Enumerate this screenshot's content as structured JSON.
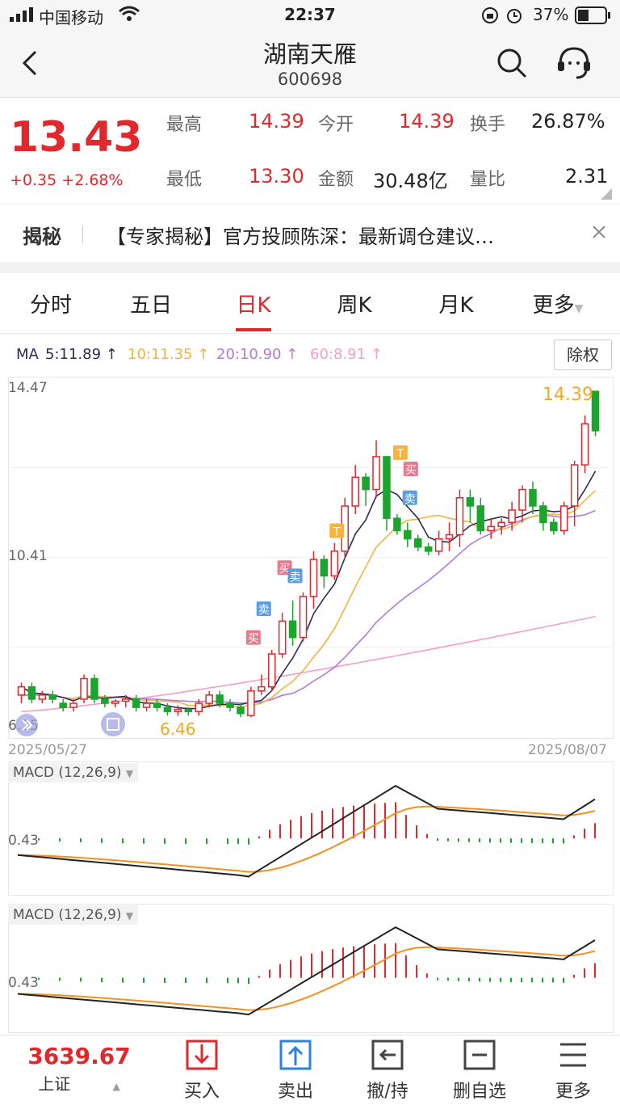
{
  "status_bar": {
    "carrier": "中国移动",
    "time": "22:37",
    "battery": "37%"
  },
  "nav": {
    "title": "湖南天雁",
    "code": "600698"
  },
  "quote": {
    "price": "13.43",
    "change": "+0.35",
    "change_pct": "+2.68%",
    "high_label": "最高",
    "high": "14.39",
    "open_label": "今开",
    "open": "14.39",
    "turnover_label": "换手",
    "turnover": "26.87%",
    "low_label": "最低",
    "low": "13.30",
    "amount_label": "金额",
    "amount": "30.48亿",
    "vol_ratio_label": "量比",
    "vol_ratio": "2.31"
  },
  "reveal": {
    "tag": "揭秘",
    "text": "【专家揭秘】官方投顾陈深：最新调仓建议…"
  },
  "tabs": [
    "分时",
    "五日",
    "日K",
    "周K",
    "月K",
    "更多"
  ],
  "active_tab": "日K",
  "ma_legend": {
    "label": "MA",
    "ma5": "5:11.89 ↑",
    "ma10": "10:11.35 ↑",
    "ma20": "20:10.90 ↑",
    "ma60": "60:8.91 ↑",
    "rights_button": "除权"
  },
  "colors": {
    "up": "#e1282c",
    "down": "#1aa52e",
    "ma5": "#2a2a55",
    "ma10": "#f5b340",
    "ma20": "#b07be0",
    "ma60": "#f2a0c8"
  },
  "kline": {
    "y_top": "14.47",
    "y_mid": "10.41",
    "y_bottom": "6.25",
    "date_start": "2025/05/27",
    "date_end": "2025/08/07",
    "low_marker": "6.46",
    "high_marker": "14.39",
    "signals": [
      "T",
      "买",
      "卖",
      "T",
      "买",
      "卖",
      "卖",
      "买"
    ]
  },
  "macd1": {
    "title": "MACD (12,26,9)",
    "value": "0.43"
  },
  "macd2": {
    "title": "MACD (12,26,9)",
    "value": "0.43"
  },
  "bottom_bar": {
    "index_value": "3639.67",
    "index_name": "上证",
    "buy": "买入",
    "sell": "卖出",
    "cancel": "撤/持",
    "remove": "删自选",
    "more": "更多"
  },
  "chart_data": {
    "type": "candlestick",
    "title": "",
    "x_range": [
      "2025/05/27",
      "2025/08/07"
    ],
    "ylim": [
      6.25,
      14.47
    ],
    "candles": [
      [
        7.0,
        7.2,
        6.8,
        7.3
      ],
      [
        7.2,
        6.9,
        6.8,
        7.3
      ],
      [
        6.9,
        7.0,
        6.8,
        7.1
      ],
      [
        7.0,
        6.9,
        6.8,
        7.1
      ],
      [
        6.8,
        6.7,
        6.6,
        6.9
      ],
      [
        6.7,
        6.8,
        6.6,
        6.9
      ],
      [
        6.9,
        7.4,
        6.8,
        7.5
      ],
      [
        7.4,
        6.9,
        6.8,
        7.5
      ],
      [
        6.9,
        6.8,
        6.7,
        7.0
      ],
      [
        6.8,
        6.85,
        6.7,
        6.9
      ],
      [
        6.85,
        6.9,
        6.7,
        7.0
      ],
      [
        6.9,
        6.7,
        6.6,
        7.0
      ],
      [
        6.7,
        6.8,
        6.6,
        6.9
      ],
      [
        6.8,
        6.7,
        6.6,
        6.9
      ],
      [
        6.7,
        6.6,
        6.5,
        6.8
      ],
      [
        6.6,
        6.65,
        6.5,
        6.75
      ],
      [
        6.65,
        6.6,
        6.5,
        6.7
      ],
      [
        6.6,
        6.8,
        6.5,
        6.9
      ],
      [
        6.8,
        7.0,
        6.7,
        7.1
      ],
      [
        7.0,
        6.8,
        6.7,
        7.1
      ],
      [
        6.8,
        6.7,
        6.6,
        6.9
      ],
      [
        6.7,
        6.55,
        6.46,
        6.8
      ],
      [
        6.5,
        7.1,
        6.46,
        7.2
      ],
      [
        7.1,
        7.2,
        7.0,
        7.5
      ],
      [
        7.2,
        8.0,
        7.1,
        8.1
      ],
      [
        8.0,
        8.8,
        7.9,
        9.0
      ],
      [
        8.8,
        8.4,
        8.2,
        9.3
      ],
      [
        8.4,
        9.4,
        8.3,
        9.5
      ],
      [
        9.4,
        10.3,
        9.1,
        10.5
      ],
      [
        10.3,
        9.9,
        9.6,
        10.4
      ],
      [
        9.9,
        10.5,
        9.8,
        10.7
      ],
      [
        10.5,
        11.6,
        10.3,
        11.8
      ],
      [
        11.6,
        12.3,
        11.4,
        12.6
      ],
      [
        12.3,
        12.0,
        11.6,
        12.4
      ],
      [
        12.0,
        12.8,
        11.8,
        13.2
      ],
      [
        12.8,
        11.3,
        11.0,
        12.2
      ],
      [
        11.3,
        11.0,
        10.9,
        11.4
      ],
      [
        11.0,
        10.8,
        10.6,
        11.2
      ],
      [
        10.8,
        10.6,
        10.5,
        10.9
      ],
      [
        10.6,
        10.5,
        10.4,
        10.7
      ],
      [
        10.5,
        10.8,
        10.4,
        11.0
      ],
      [
        10.8,
        10.9,
        10.5,
        11.2
      ],
      [
        10.9,
        11.8,
        10.6,
        12.0
      ],
      [
        11.8,
        11.6,
        11.2,
        12.0
      ],
      [
        11.6,
        11.0,
        10.9,
        11.8
      ],
      [
        11.0,
        11.1,
        10.8,
        11.3
      ],
      [
        11.1,
        11.2,
        10.9,
        11.3
      ],
      [
        11.2,
        11.5,
        11.0,
        11.7
      ],
      [
        11.5,
        12.0,
        11.2,
        12.1
      ],
      [
        12.0,
        11.6,
        11.4,
        12.2
      ],
      [
        11.6,
        11.2,
        11.0,
        11.7
      ],
      [
        11.2,
        11.0,
        10.9,
        11.3
      ],
      [
        11.0,
        11.6,
        10.9,
        11.7
      ],
      [
        11.6,
        12.6,
        11.1,
        12.7
      ],
      [
        12.6,
        13.6,
        12.4,
        13.8
      ],
      [
        14.39,
        13.43,
        13.3,
        14.39
      ]
    ],
    "ma5_end": 11.89,
    "ma10_end": 11.35,
    "ma20_end": 10.9,
    "ma60_end": 8.91
  }
}
